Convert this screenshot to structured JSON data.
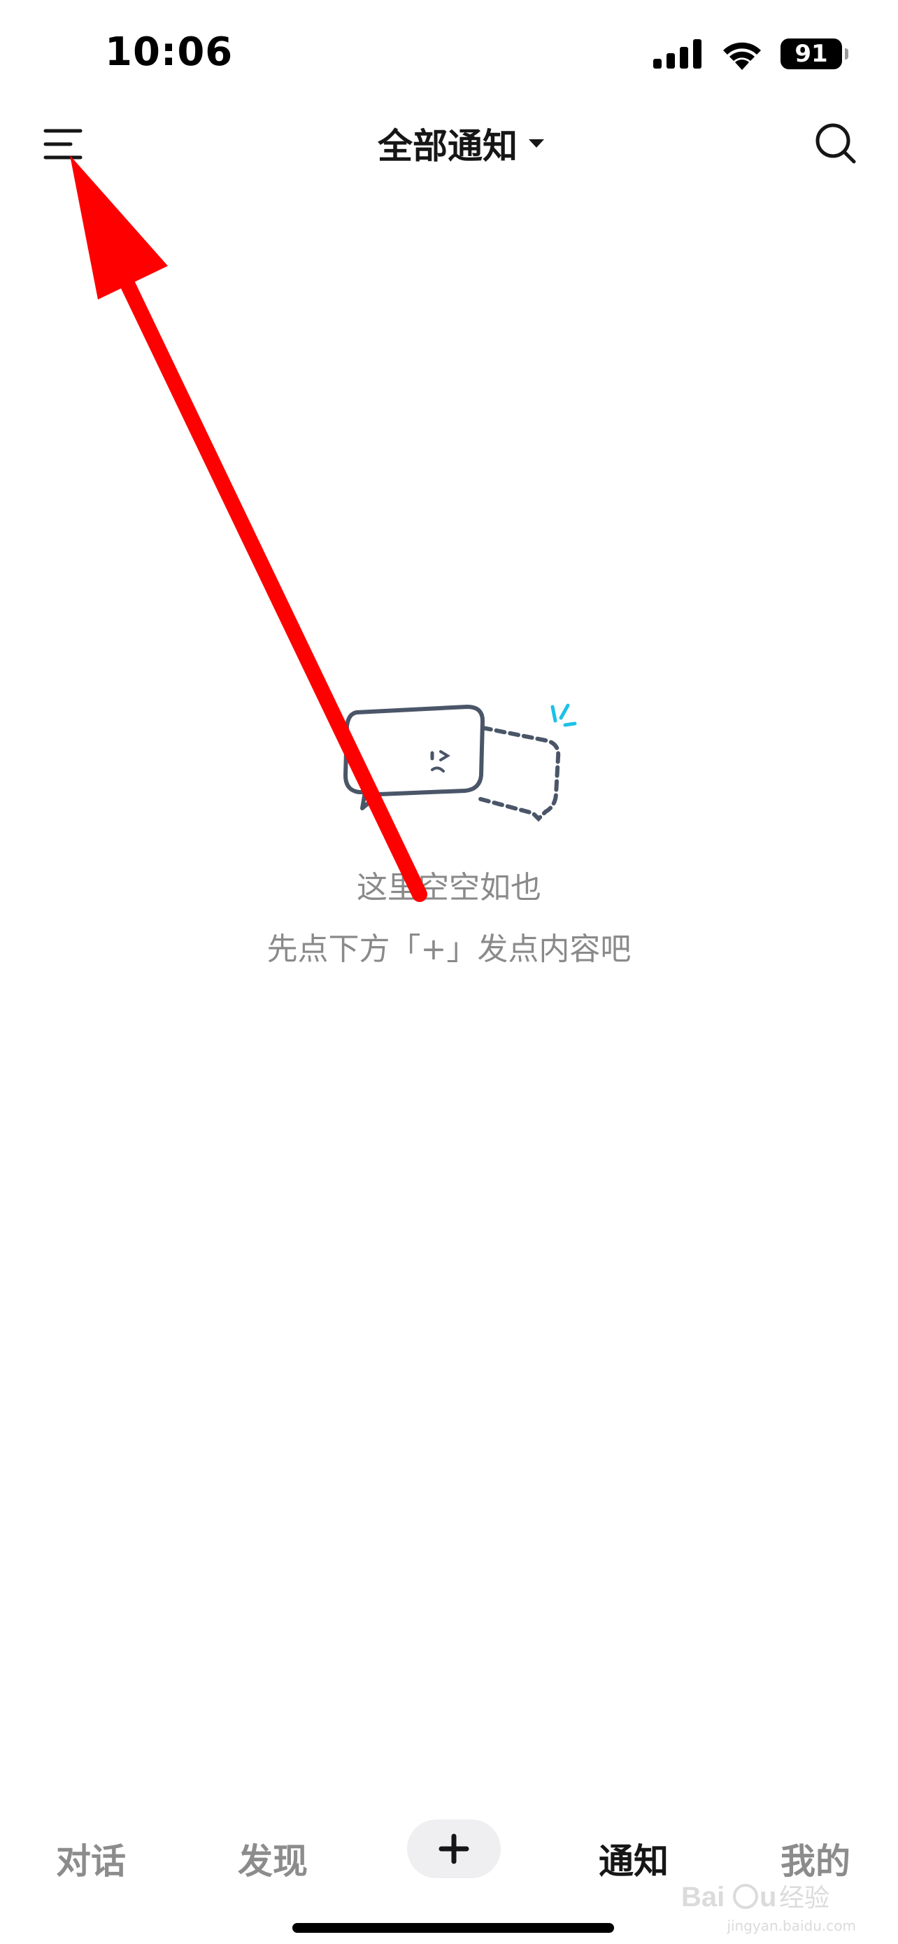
{
  "status_bar": {
    "time": "10:06",
    "battery": "91",
    "icons": [
      "signal-icon",
      "wifi-icon",
      "battery-icon"
    ]
  },
  "nav_bar": {
    "menu_icon": "menu-icon",
    "title": "全部通知",
    "title_dropdown_icon": "caret-down-icon",
    "search_icon": "search-icon"
  },
  "empty_state": {
    "illustration": "empty-chat-bubbles-illustration",
    "title": "这里空空如也",
    "subtitle": "先点下方「+」发点内容吧"
  },
  "tab_bar": {
    "tabs": [
      {
        "label": "对话",
        "active": false
      },
      {
        "label": "发现",
        "active": false
      },
      {
        "label": "通知",
        "active": true
      },
      {
        "label": "我的",
        "active": false
      }
    ],
    "add_icon": "plus-icon"
  },
  "annotation": {
    "type": "arrow",
    "color": "#ff0000"
  },
  "watermark": {
    "logo": "Baidu经验",
    "url": "jingyan.baidu.com"
  },
  "colors": {
    "text_primary": "#161616",
    "text_secondary": "#8a8a8a",
    "tab_inactive": "#8c8c8c",
    "add_button_bg": "#efeff1",
    "accent_cyan": "#1cc1e8",
    "arrow": "#ff0000"
  }
}
